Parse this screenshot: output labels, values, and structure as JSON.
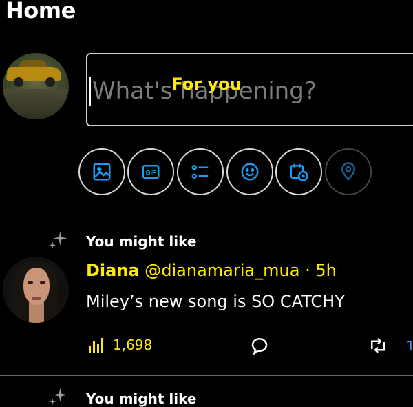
{
  "header": {
    "title": "Home"
  },
  "tabs": {
    "active_label": "For you"
  },
  "composer": {
    "placeholder": "What's happening?"
  },
  "toolbar": {
    "icons": [
      "image-icon",
      "gif-icon",
      "poll-icon",
      "emoji-icon",
      "schedule-icon",
      "location-icon"
    ],
    "gif_label": "GIF"
  },
  "feed": {
    "recommendation_label": "You might like",
    "post": {
      "author_name": "Diana",
      "author_handle": "@dianamaria_mua",
      "separator": "·",
      "time": "5h",
      "text": "Miley’s new song is SO CATCHY",
      "views": "1,698"
    },
    "next_recommendation_label": "You might like"
  },
  "colors": {
    "background": "#000000",
    "accent_text": "#ffeb00",
    "icon_blue": "#1d9bf0",
    "border": "#cfcfcf"
  }
}
